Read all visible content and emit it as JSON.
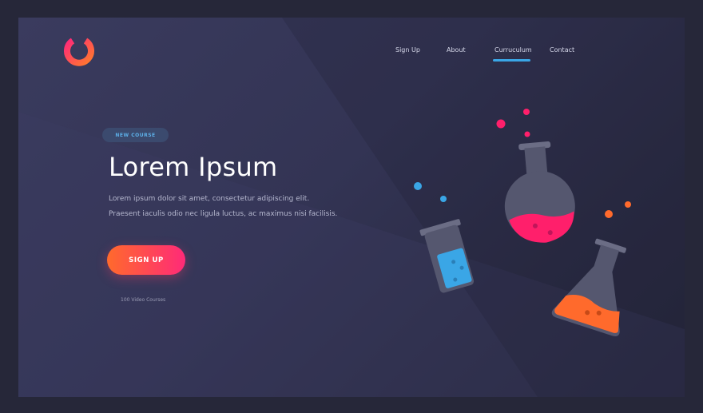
{
  "header": {
    "logo_icon": "ring-logo-icon",
    "nav": [
      {
        "label": "Sign Up",
        "active": false
      },
      {
        "label": "About",
        "active": false
      },
      {
        "label": "Curruculum",
        "active": true
      },
      {
        "label": "Contact",
        "active": false
      }
    ]
  },
  "hero": {
    "badge": "NEW COURSE",
    "title": "Lorem Ipsum",
    "description": [
      "Lorem ipsum dolor sit amet, consectetur adipiscing elit.",
      "Praesent iaculis odio nec ligula luctus, ac maximus nisi facilisis."
    ],
    "cta_label": "SIGN UP",
    "courses_note": "100 Video Courses"
  },
  "illustration": {
    "icons": [
      "beaker-icon",
      "round-flask-icon",
      "erlenmeyer-flask-icon"
    ],
    "colors": {
      "blue": "#3aa6e6",
      "pink": "#ff1f6b",
      "orange": "#ff6a2c"
    }
  },
  "colors": {
    "background": "#262739",
    "accent_blue": "#3aa6e6",
    "cta_start": "#ff6a2c",
    "cta_end": "#ff2a78"
  }
}
